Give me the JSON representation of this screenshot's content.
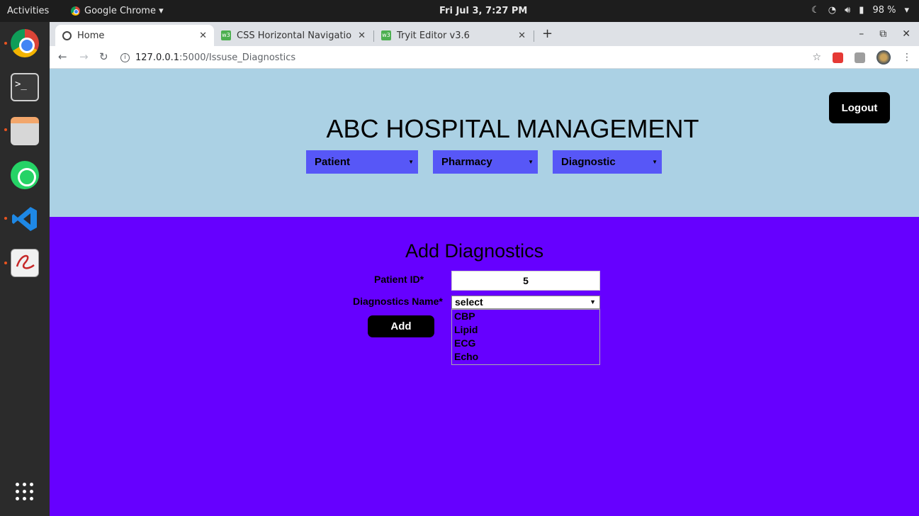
{
  "system": {
    "activities": "Activities",
    "app_name": "Google Chrome ▾",
    "clock": "Fri Jul  3,  7:27 PM",
    "battery": "98 %"
  },
  "browser": {
    "tabs": [
      {
        "title": "Home"
      },
      {
        "title": "CSS Horizontal Navigatio"
      },
      {
        "title": "Tryit Editor v3.6"
      }
    ],
    "url_host": "127.0.0.1",
    "url_path": ":5000/Issuse_Diagnostics"
  },
  "header": {
    "title": "ABC HOSPITAL MANAGEMENT",
    "logout_label": "Logout",
    "menus": [
      {
        "label": "Patient"
      },
      {
        "label": "Pharmacy"
      },
      {
        "label": "Diagnostic"
      }
    ]
  },
  "form": {
    "title": "Add Diagnostics",
    "patient_id_label": "Patient ID*",
    "patient_id_value": "5",
    "diagnostics_name_label": "Diagnostics Name*",
    "selected": "select",
    "options": [
      "CBP",
      "Lipid",
      "ECG",
      "Echo"
    ],
    "add_label": "Add"
  },
  "colors": {
    "header_bg": "#abd1e4",
    "main_bg": "#6600ff",
    "menu_bg": "#5757f7"
  }
}
